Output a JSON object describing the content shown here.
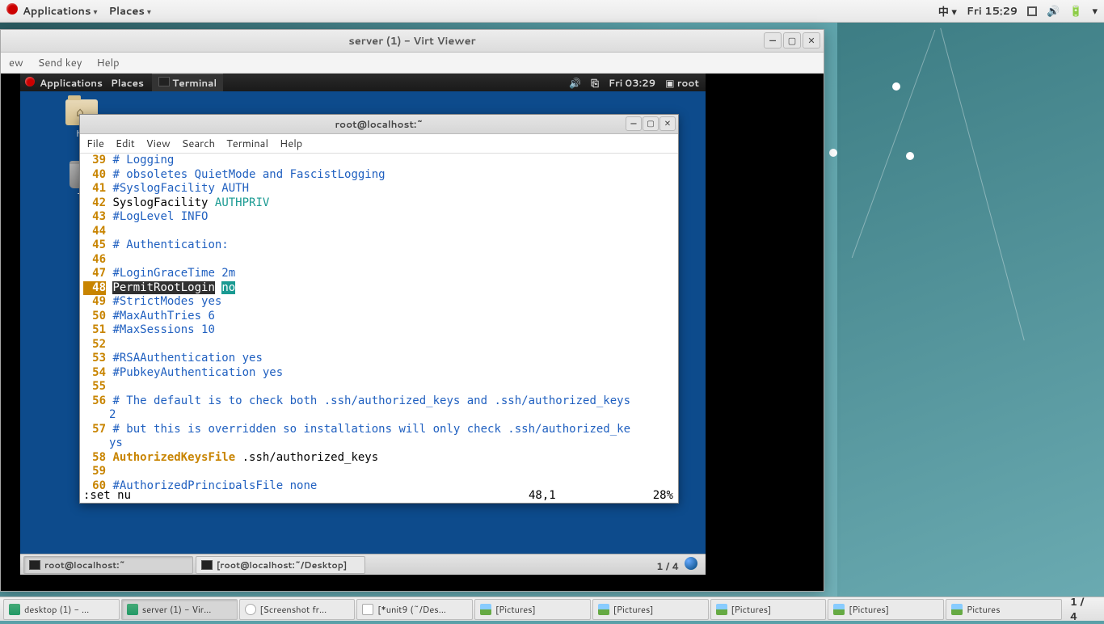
{
  "host_panel": {
    "applications": "Applications",
    "places": "Places",
    "ime": "中",
    "clock": "Fri 15:29"
  },
  "host_bg_window_close": "✕",
  "virt_viewer": {
    "title": "server (1) - Virt Viewer",
    "menu": {
      "view": "ew",
      "sendkey": "Send key",
      "help": "Help"
    },
    "btn_min": "—",
    "btn_max": "▢",
    "btn_close": "✕"
  },
  "guest_panel": {
    "applications": "Applications",
    "places": "Places",
    "terminal": "Terminal",
    "clock": "Fri 03:29",
    "user": "root",
    "sound_icon": "🔊",
    "net_icon": "⎘",
    "user_icon": "▣"
  },
  "guest_icons": {
    "home": "ho",
    "trash": "Tr"
  },
  "terminal": {
    "title": "root@localhost:~",
    "menu": {
      "file": "File",
      "edit": "Edit",
      "view": "View",
      "search": "Search",
      "terminal": "Terminal",
      "help": "Help"
    },
    "btn_min": "—",
    "btn_max": "▢",
    "btn_close": "✕",
    "lines": [
      {
        "n": "39",
        "type": "cmt",
        "text": "# Logging"
      },
      {
        "n": "40",
        "type": "cmt",
        "text": "# obsoletes QuietMode and FascistLogging"
      },
      {
        "n": "41",
        "type": "cmt",
        "text": "#SyslogFacility AUTH"
      },
      {
        "n": "42",
        "type": "kv",
        "key": "SyslogFacility",
        "val": "AUTHPRIV"
      },
      {
        "n": "43",
        "type": "cmt",
        "text": "#LogLevel INFO"
      },
      {
        "n": "44",
        "type": "blank",
        "text": ""
      },
      {
        "n": "45",
        "type": "cmt",
        "text": "# Authentication:"
      },
      {
        "n": "46",
        "type": "blank",
        "text": ""
      },
      {
        "n": "47",
        "type": "cmt",
        "text": "#LoginGraceTime 2m"
      },
      {
        "n": "48",
        "type": "hl",
        "key": "PermitRootLogin",
        "val": "no"
      },
      {
        "n": "49",
        "type": "cmt",
        "text": "#StrictModes yes"
      },
      {
        "n": "50",
        "type": "cmt",
        "text": "#MaxAuthTries 6"
      },
      {
        "n": "51",
        "type": "cmt",
        "text": "#MaxSessions 10"
      },
      {
        "n": "52",
        "type": "blank",
        "text": ""
      },
      {
        "n": "53",
        "type": "cmt",
        "text": "#RSAAuthentication yes"
      },
      {
        "n": "54",
        "type": "cmt",
        "text": "#PubkeyAuthentication yes"
      },
      {
        "n": "55",
        "type": "blank",
        "text": ""
      },
      {
        "n": "56",
        "type": "wrap",
        "text": "# The default is to check both .ssh/authorized_keys and .ssh/authorized_keys",
        "cont": "2"
      },
      {
        "n": "57",
        "type": "wrap",
        "text": "# but this is overridden so installations will only check .ssh/authorized_ke",
        "cont": "ys"
      },
      {
        "n": "58",
        "type": "kv2",
        "key": "AuthorizedKeysFile",
        "val": ".ssh/authorized_keys"
      },
      {
        "n": "59",
        "type": "blank",
        "text": ""
      },
      {
        "n": "60",
        "type": "cmt",
        "text": "#AuthorizedPrincipalsFile none"
      }
    ],
    "status_cmd": ":set nu",
    "status_pos": "48,1",
    "status_pct": "28%"
  },
  "guest_taskbar": {
    "t1": "root@localhost:~",
    "t2": "[root@localhost:~/Desktop]",
    "ws": "1 / 4"
  },
  "host_taskbar": {
    "items": [
      {
        "icon": "monitor",
        "label": "desktop (1) - ..."
      },
      {
        "icon": "monitor",
        "label": "server (1) - Vir...",
        "active": true
      },
      {
        "icon": "search",
        "label": "[Screenshot fr..."
      },
      {
        "icon": "edit",
        "label": "[*unit9 (~/Des..."
      },
      {
        "icon": "img",
        "label": "[Pictures]"
      },
      {
        "icon": "img",
        "label": "[Pictures]"
      },
      {
        "icon": "img",
        "label": "[Pictures]"
      },
      {
        "icon": "img",
        "label": "[Pictures]"
      },
      {
        "icon": "img",
        "label": "Pictures"
      }
    ],
    "ws": "1 / 4"
  }
}
